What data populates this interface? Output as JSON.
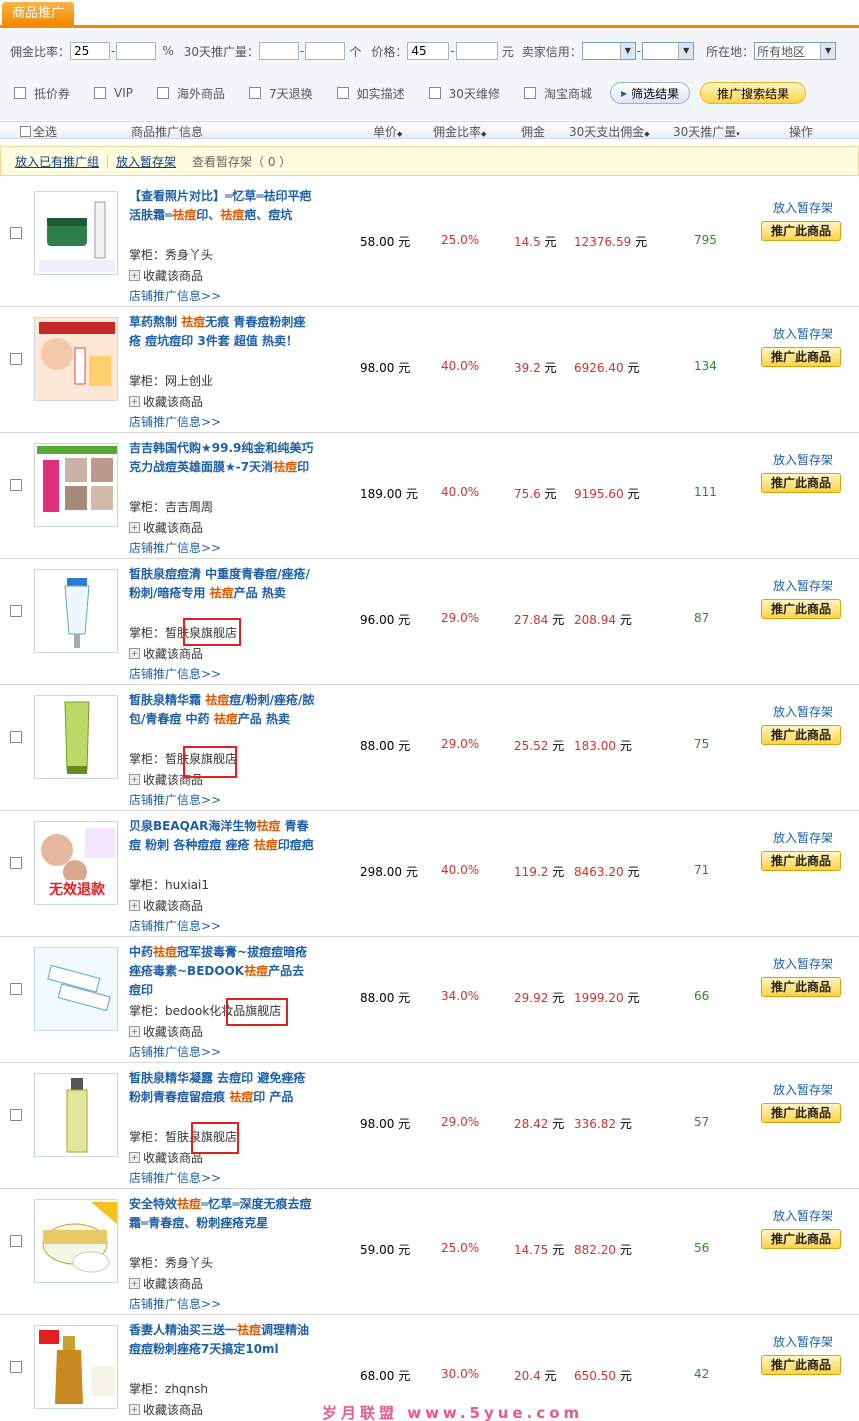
{
  "tab": {
    "label": "商品推广"
  },
  "filters": {
    "commission_rate_label": "佣金比率：",
    "commission_rate_min": "25",
    "commission_rate_max": "",
    "percent_unit": "%",
    "sales_label": "30天推广量：",
    "sales_min": "",
    "sales_max": "",
    "sales_unit": "个",
    "price_label": "价格：",
    "price_min": "45",
    "price_max": "",
    "price_unit": "元",
    "seller_credit_label": "卖家信用：",
    "location_label": "所在地：",
    "location_value": "所有地区",
    "dash": "-",
    "checkboxes": [
      "抵价券",
      "VIP",
      "海外商品",
      "7天退换",
      "如实描述",
      "30天维修",
      "淘宝商城"
    ],
    "filter_button": "筛选结果",
    "promote_search_button": "推广搜索结果"
  },
  "table_header": {
    "select_all": "全选",
    "info": "商品推广信息",
    "price": "单价",
    "rate": "佣金比率",
    "commission": "佣金",
    "spend": "30天支出佣金",
    "sales": "30天推广量",
    "op": "操作"
  },
  "actions": {
    "add_group": "放入已有推广组",
    "add_shelf": "放入暂存架",
    "view_shelf": "查看暂存架（ 0 ）"
  },
  "row_labels": {
    "keeper": "掌柜：",
    "favorite": "收藏该商品",
    "shop_promo": "店铺推广信息>>",
    "add_to_shelf": "放入暂存架",
    "promote": "推广此商品",
    "yuan": "元"
  },
  "rows": [
    {
      "title_parts": [
        "【查看照片对比】═忆草═祛印平疤活肤霜═",
        "祛痘",
        "印、",
        "祛痘",
        "疤、痘坑"
      ],
      "shop": "秀身丫头",
      "price": "58.00",
      "rate": "25.0%",
      "commission": "14.5",
      "spend": "12376.59",
      "sales": "795"
    },
    {
      "title_parts": [
        "草药熬制 ",
        "祛痘",
        "无痕 青春痘粉刺痤疮 痘坑痘印 3件套 超值 热卖！"
      ],
      "shop": "网上创业",
      "price": "98.00",
      "rate": "40.0%",
      "commission": "39.2",
      "spend": "6926.40",
      "sales": "134"
    },
    {
      "title_parts": [
        "吉吉韩国代购★99.9纯金和纯美巧克力战痘英雄面膜★-7天消",
        "祛痘",
        "印"
      ],
      "shop": "吉吉周周",
      "price": "189.00",
      "rate": "40.0%",
      "commission": "75.6",
      "spend": "9195.60",
      "sales": "111"
    },
    {
      "title_parts": [
        "皙肤泉痘痘清 中重度青春痘/痤疮/粉刺/暗疮专用 ",
        "祛痘",
        "产品 热卖"
      ],
      "shop": "皙肤泉旗舰店",
      "price": "96.00",
      "rate": "29.0%",
      "commission": "27.84",
      "spend": "208.94",
      "sales": "87"
    },
    {
      "title_parts": [
        "皙肤泉精华霜 ",
        "祛痘",
        "痘/粉刺/痤疮/脓包/青春痘 中药 ",
        "祛痘",
        "产品 热卖"
      ],
      "shop": "皙肤泉旗舰店",
      "price": "88.00",
      "rate": "29.0%",
      "commission": "25.52",
      "spend": "183.00",
      "sales": "75"
    },
    {
      "title_parts": [
        "贝泉BEAQAR海洋生物",
        "祛痘",
        " 青春痘 粉刺 各种痘痘 痤疮 ",
        "祛痘",
        "印痘疤"
      ],
      "shop": "huxiai1",
      "price": "298.00",
      "rate": "40.0%",
      "commission": "119.2",
      "spend": "8463.20",
      "sales": "71"
    },
    {
      "title_parts": [
        "中药",
        "祛痘",
        "冠军拔毒膏~拔痘痘暗疮痤疮毒素~BEDOOK",
        "祛痘",
        "产品去痘印"
      ],
      "shop": "bedook化妆品旗舰店",
      "price": "88.00",
      "rate": "34.0%",
      "commission": "29.92",
      "spend": "1999.20",
      "sales": "66"
    },
    {
      "title_parts": [
        "皙肤泉精华凝露 去痘印 避免痤疮粉刺青春痘留痘痕 ",
        "祛痘",
        "印 产品"
      ],
      "shop": "皙肤泉旗舰店",
      "price": "98.00",
      "rate": "29.0%",
      "commission": "28.42",
      "spend": "336.82",
      "sales": "57"
    },
    {
      "title_parts": [
        "安全特效",
        "祛痘",
        "═忆草═深度无痕去痘霜═青春痘、粉刺痤疮克星"
      ],
      "shop": "秀身丫头",
      "price": "59.00",
      "rate": "25.0%",
      "commission": "14.75",
      "spend": "882.20",
      "sales": "56"
    },
    {
      "title_parts": [
        "香妻人精油买三送一",
        "祛痘",
        "调理精油 痘痘粉刺痤疮7天搞定10ml"
      ],
      "shop": "zhqnsh",
      "price": "68.00",
      "rate": "30.0%",
      "commission": "20.4",
      "spend": "650.50",
      "sales": "42"
    }
  ],
  "watermark": "岁月联盟 www.5yue.com"
}
